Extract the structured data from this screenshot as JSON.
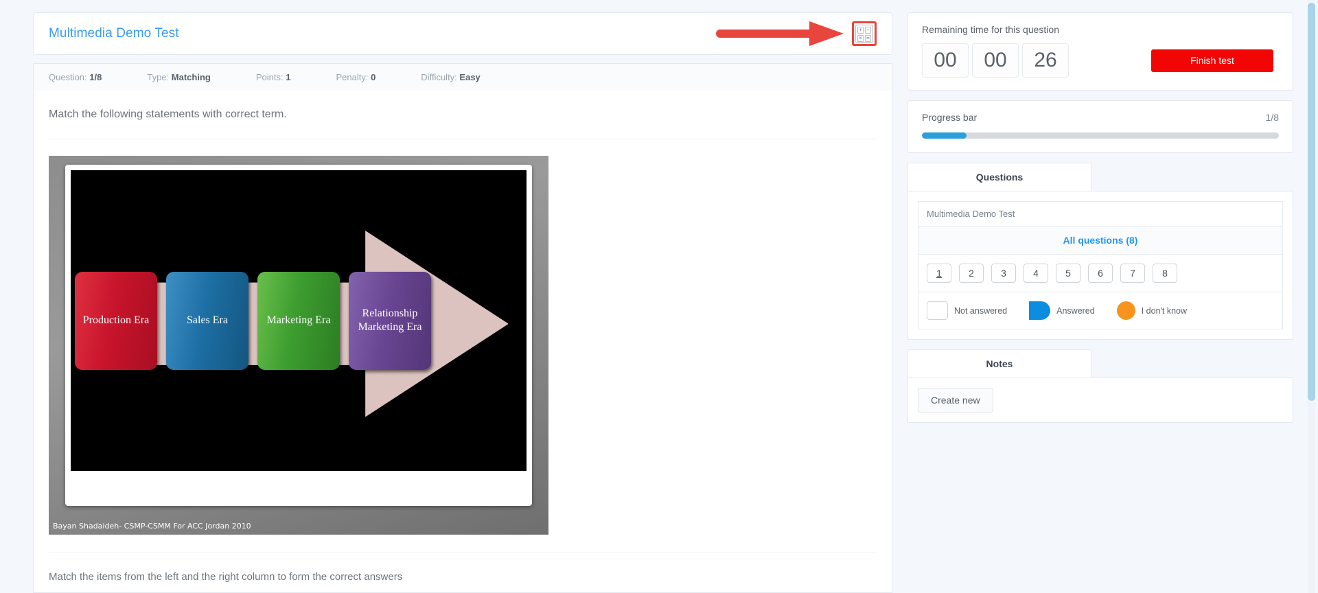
{
  "test": {
    "title": "Multimedia Demo Test"
  },
  "toolbar": {
    "calculator_icon": "calculator-icon",
    "calc_keys": [
      "+",
      "−",
      "×",
      "="
    ]
  },
  "meta": {
    "question_label": "Question:",
    "question_value": "1/8",
    "type_label": "Type:",
    "type_value": "Matching",
    "points_label": "Points:",
    "points_value": "1",
    "penalty_label": "Penalty:",
    "penalty_value": "0",
    "difficulty_label": "Difficulty:",
    "difficulty_value": "Easy"
  },
  "question": {
    "prompt": "Match the following statements with correct term.",
    "hint": "Match the items from the left and the right column to form the correct answers",
    "slide": {
      "caption": "Bayan Shadaideh- CSMP-CSMM For ACC Jordan 2010",
      "boxes": [
        {
          "label": "Production Era",
          "color": "#c8142c"
        },
        {
          "label": "Sales Era",
          "color": "#1d6fa5"
        },
        {
          "label": "Marketing Era",
          "color": "#3d9d30"
        },
        {
          "label": "Relationship Marketing Era",
          "color": "#6a4693"
        }
      ]
    }
  },
  "timer": {
    "label": "Remaining time for this question",
    "hours": "00",
    "minutes": "00",
    "seconds": "26",
    "finish_label": "Finish test",
    "finish_color": "#f20505"
  },
  "progress": {
    "label": "Progress bar",
    "count": "1/8",
    "percent": 12.5,
    "fill_color": "#2b9fd8"
  },
  "questions_panel": {
    "tab_label": "Questions",
    "list_title": "Multimedia Demo Test",
    "all_questions_label": "All questions (8)",
    "numbers": [
      "1",
      "2",
      "3",
      "4",
      "5",
      "6",
      "7",
      "8"
    ],
    "current": "1",
    "legend": [
      {
        "label": "Not answered",
        "color": "#ffffff"
      },
      {
        "label": "Answered",
        "color": "#0b8ee0"
      },
      {
        "label": "I don't know",
        "color": "#f7941d"
      }
    ]
  },
  "notes_panel": {
    "tab_label": "Notes",
    "create_label": "Create new"
  }
}
